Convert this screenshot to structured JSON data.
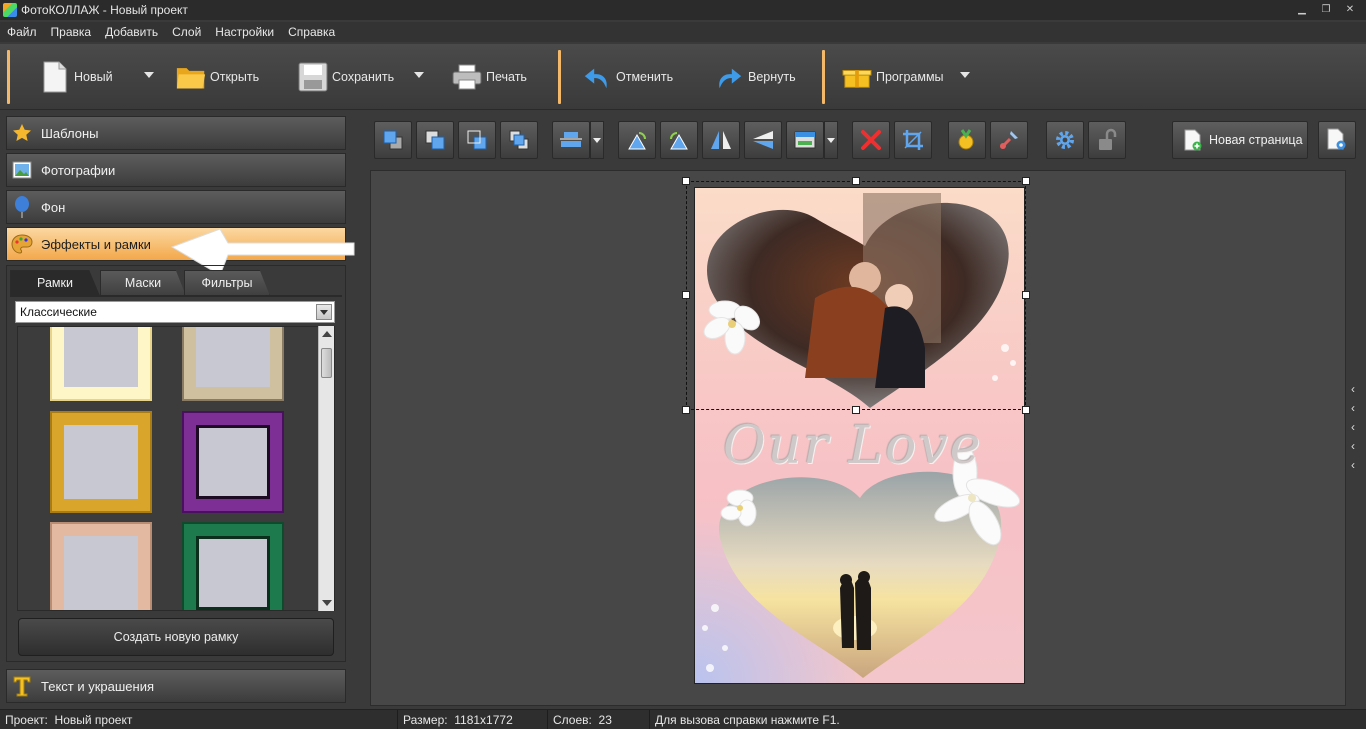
{
  "window": {
    "title": "ФотоКОЛЛАЖ - Новый проект"
  },
  "menu": [
    "Файл",
    "Правка",
    "Добавить",
    "Слой",
    "Настройки",
    "Справка"
  ],
  "toolbar": {
    "new": "Новый",
    "open": "Открыть",
    "save": "Сохранить",
    "print": "Печать",
    "undo": "Отменить",
    "redo": "Вернуть",
    "programs": "Программы"
  },
  "sidebar": {
    "sections": [
      {
        "label": "Шаблоны",
        "icon": "star-icon"
      },
      {
        "label": "Фотографии",
        "icon": "photo-icon"
      },
      {
        "label": "Фон",
        "icon": "balloon-icon"
      },
      {
        "label": "Эффекты и рамки",
        "icon": "palette-icon",
        "active": true
      }
    ],
    "tabs": [
      "Рамки",
      "Маски",
      "Фильтры"
    ],
    "frame_category": "Классические",
    "create_frame": "Создать новую рамку",
    "text_section": {
      "label": "Текст и украшения",
      "icon": "text-t-icon"
    }
  },
  "editor": {
    "new_page": "Новая страница",
    "collage_text": "Our Love"
  },
  "status": {
    "project_label": "Проект:",
    "project_value": "Новый проект",
    "size_label": "Размер:",
    "size_value": "1181x1772",
    "layers_label": "Слоев:",
    "layers_value": "23",
    "help": "Для вызова справки нажмите F1."
  },
  "colors": {
    "accent": "#f3a84a",
    "dark_bg": "#3a3a3a"
  }
}
